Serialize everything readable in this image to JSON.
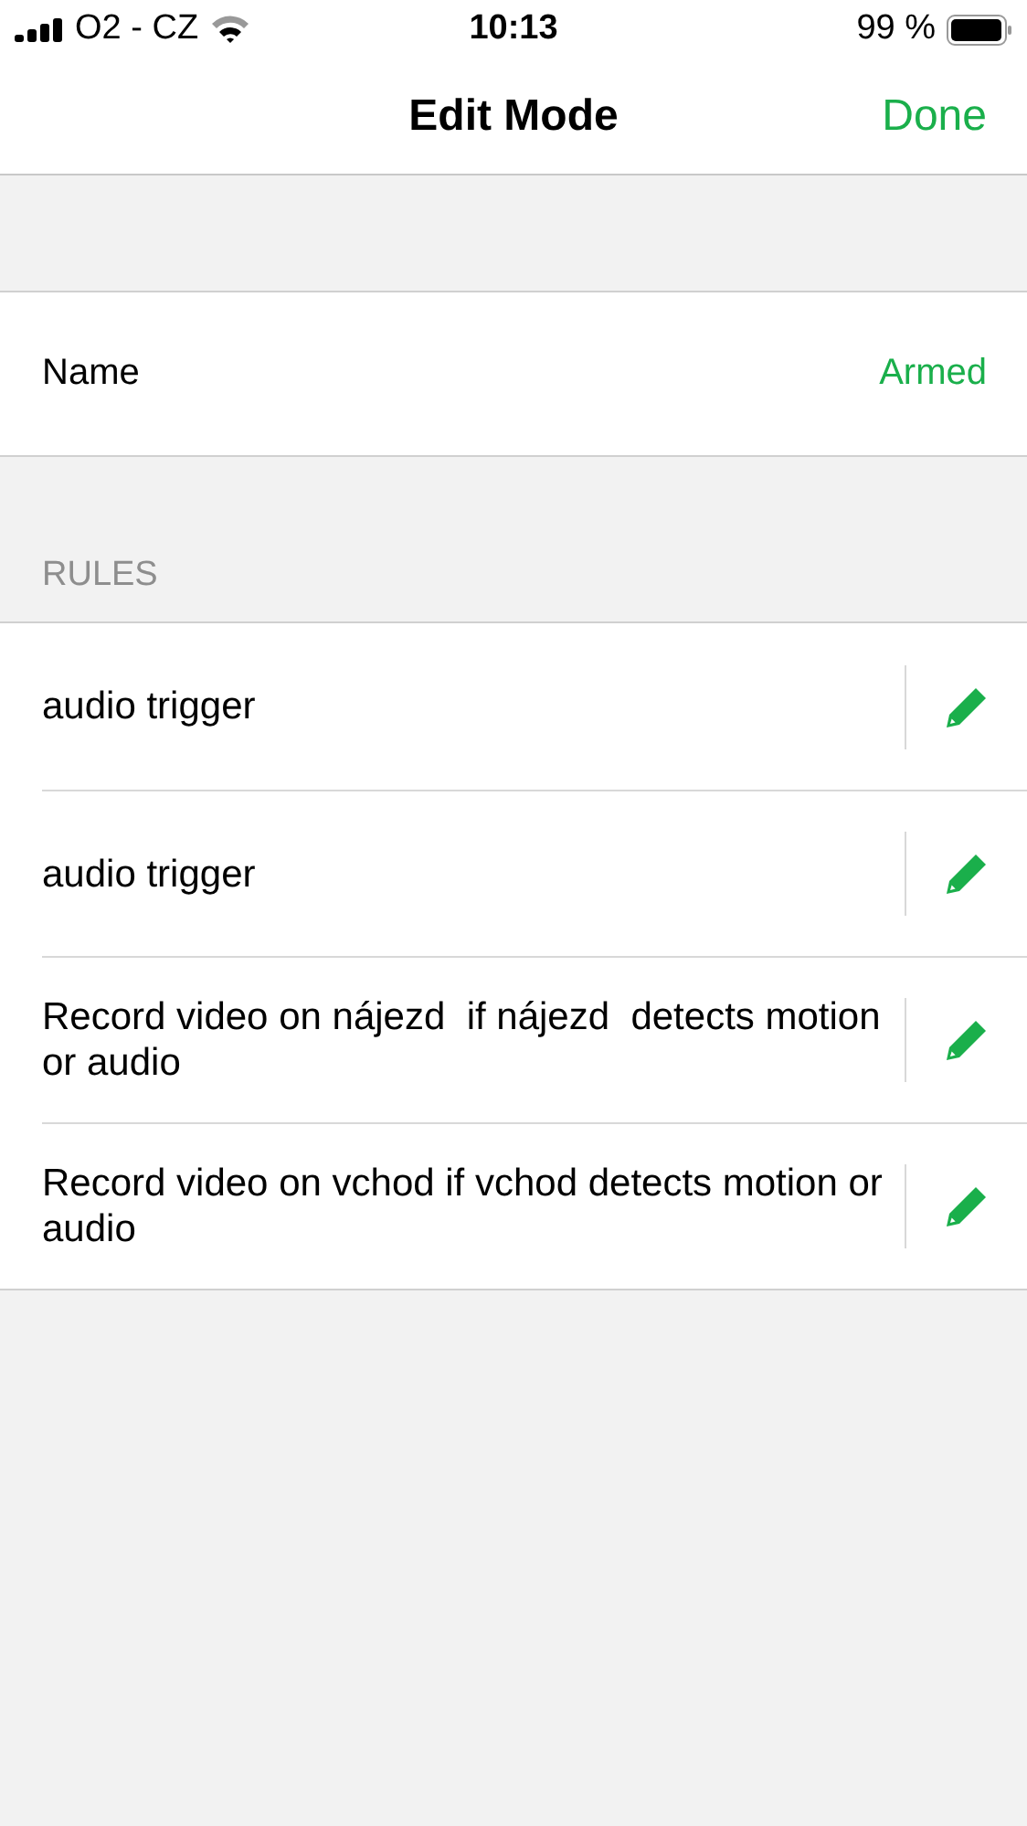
{
  "status_bar": {
    "carrier": "O2 - CZ",
    "time": "10:13",
    "battery_text": "99 %"
  },
  "nav": {
    "title": "Edit Mode",
    "done": "Done"
  },
  "name_row": {
    "label": "Name",
    "value": "Armed"
  },
  "rules": {
    "header": "RULES",
    "items": [
      {
        "text": "audio trigger"
      },
      {
        "text": "audio trigger"
      },
      {
        "text": "Record video on nájezd  if nájezd  detects motion or audio"
      },
      {
        "text": "Record video on vchod if vchod detects motion or audio"
      }
    ]
  }
}
